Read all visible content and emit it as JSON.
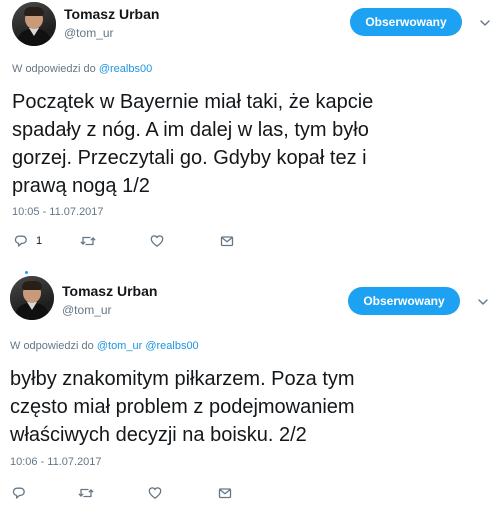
{
  "tweets": [
    {
      "author": "Tomasz Urban",
      "handle": "@tom_ur",
      "follow_label": "Obserwowany",
      "reply_prefix": "W odpowiedzi do",
      "reply_mentions": [
        "@realbs00"
      ],
      "text_lines": [
        "Początek w Bayernie miał taki, że kapcie",
        "spadały z nóg. A im dalej w las, tym było",
        "gorzej. Przeczytali go. Gdyby kopał tez i",
        "prawą nogą 1/2"
      ],
      "timestamp": "10:05 - 11.07.2017",
      "actions": {
        "reply_icon": "reply-icon",
        "reply_count": "1",
        "retweet_icon": "retweet-icon",
        "like_icon": "heart-icon",
        "dm_icon": "envelope-icon"
      }
    },
    {
      "author": "Tomasz Urban",
      "handle": "@tom_ur",
      "follow_label": "Obserwowany",
      "reply_prefix": "W odpowiedzi do",
      "reply_mentions": [
        "@tom_ur",
        "@realbs00"
      ],
      "text_lines": [
        "byłby znakomitym piłkarzem. Poza tym",
        "często miał problem z podejmowaniem",
        "właściwych decyzji na boisku. 2/2"
      ],
      "timestamp": "10:06 - 11.07.2017",
      "actions": {
        "reply_icon": "reply-icon",
        "reply_count": "",
        "retweet_icon": "retweet-icon",
        "like_icon": "heart-icon",
        "dm_icon": "envelope-icon"
      }
    }
  ],
  "colors": {
    "accent": "#1da1f2",
    "mention": "#1b95e0",
    "muted": "#657786",
    "text": "#14171a"
  }
}
